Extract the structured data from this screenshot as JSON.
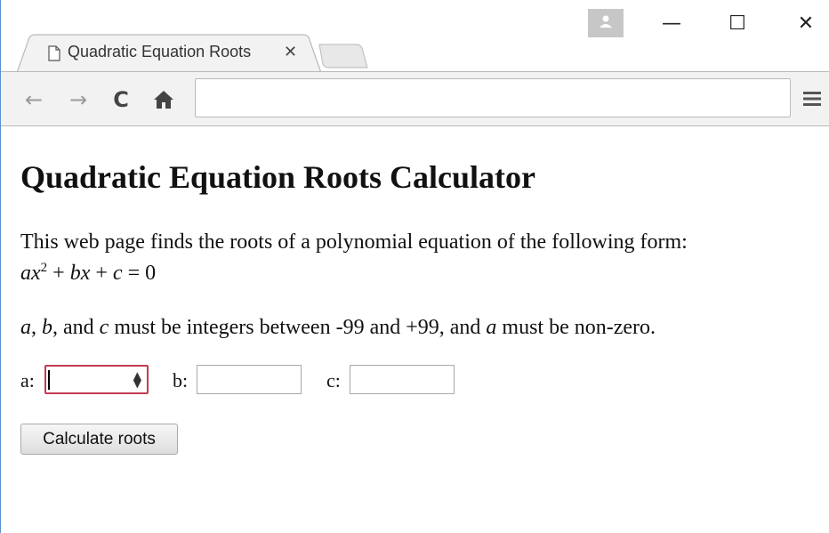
{
  "tab": {
    "title": "Quadratic Equation Roots"
  },
  "window": {
    "close_glyph": "✕",
    "maximize_glyph": "☐",
    "minimize_glyph": "—"
  },
  "toolbar": {
    "url": ""
  },
  "page": {
    "heading": "Quadratic Equation Roots Calculator",
    "intro": "This web page finds the roots of a polynomial equation of the following form:",
    "equation": {
      "a": "a",
      "x1": "x",
      "exp": "2",
      "plus1": " + ",
      "b": "b",
      "x2": "x",
      "plus2": " + ",
      "c": "c",
      "equals": " = 0"
    },
    "constraint": {
      "a": "a",
      "sep1": ", ",
      "b": "b",
      "sep2": ", and ",
      "c": "c",
      "mid": " must be integers between -99 and +99, and ",
      "a2": "a",
      "end": " must be non-zero."
    },
    "fields": {
      "a_label": "a:",
      "b_label": "b:",
      "c_label": "c:",
      "a_value": "",
      "b_value": "",
      "c_value": ""
    },
    "button_label": "Calculate roots"
  }
}
